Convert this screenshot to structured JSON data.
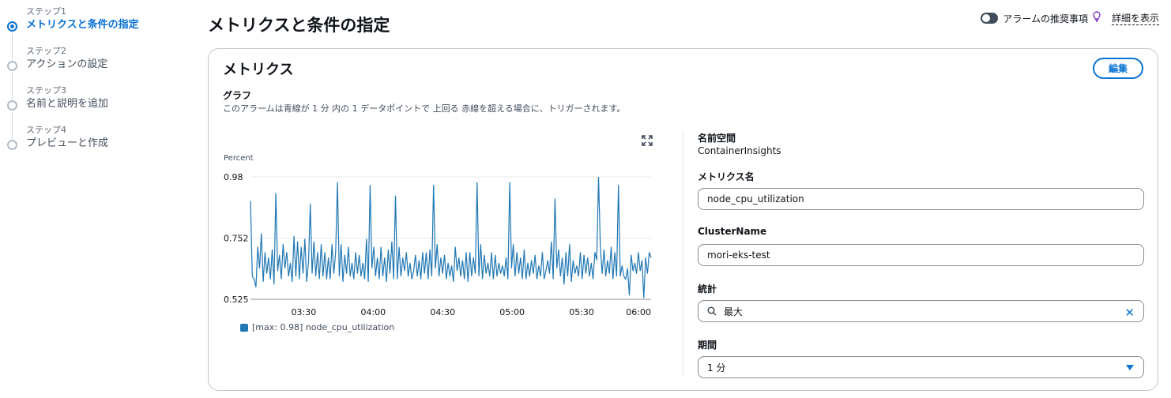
{
  "steps": [
    {
      "sub": "ステップ1",
      "title": "メトリクスと条件の指定",
      "active": true
    },
    {
      "sub": "ステップ2",
      "title": "アクションの設定",
      "active": false
    },
    {
      "sub": "ステップ3",
      "title": "名前と説明を追加",
      "active": false
    },
    {
      "sub": "ステップ4",
      "title": "プレビューと作成",
      "active": false
    }
  ],
  "header": {
    "title": "メトリクスと条件の指定",
    "recommendations_label": "アラームの推奨事項",
    "info_link": "詳細を表示"
  },
  "card": {
    "title": "メトリクス",
    "edit_label": "編集",
    "graph_label": "グラフ",
    "graph_desc": "このアラームは青線が 1 分 内の 1 データポイントで 上回る 赤線を超える場合に、トリガーされます。"
  },
  "fields": {
    "namespace_label": "名前空間",
    "namespace_value": "ContainerInsights",
    "metric_name_label": "メトリクス名",
    "metric_name_value": "node_cpu_utilization",
    "cluster_label": "ClusterName",
    "cluster_value": "mori-eks-test",
    "stat_label": "統計",
    "stat_value": "最大",
    "period_label": "期間",
    "period_value": "1 分"
  },
  "colors": {
    "accent": "#0972d3",
    "series": "#1f77b4"
  },
  "chart_data": {
    "type": "line",
    "ylabel": "Percent",
    "yticks": [
      0.98,
      0.752,
      0.525
    ],
    "ylim": [
      0.525,
      0.98
    ],
    "xticks": [
      "03:30",
      "04:00",
      "04:30",
      "05:00",
      "05:30",
      "06:00"
    ],
    "x_start": "03:07",
    "x_end": "06:00",
    "legend": "[max: 0.98] node_cpu_utilization",
    "series": [
      {
        "name": "node_cpu_utilization",
        "values": [
          0.89,
          0.61,
          0.6,
          0.57,
          0.72,
          0.64,
          0.77,
          0.59,
          0.7,
          0.62,
          0.68,
          0.6,
          0.71,
          0.58,
          0.92,
          0.63,
          0.69,
          0.6,
          0.73,
          0.64,
          0.7,
          0.61,
          0.66,
          0.59,
          0.76,
          0.61,
          0.74,
          0.6,
          0.72,
          0.62,
          0.75,
          0.59,
          0.66,
          0.88,
          0.62,
          0.74,
          0.61,
          0.7,
          0.6,
          0.73,
          0.61,
          0.7,
          0.6,
          0.68,
          0.6,
          0.73,
          0.62,
          0.7,
          0.96,
          0.61,
          0.73,
          0.59,
          0.69,
          0.62,
          0.72,
          0.61,
          0.66,
          0.6,
          0.7,
          0.62,
          0.69,
          0.61,
          0.66,
          0.6,
          0.75,
          0.59,
          0.95,
          0.64,
          0.72,
          0.61,
          0.68,
          0.6,
          0.72,
          0.61,
          0.68,
          0.59,
          0.71,
          0.62,
          0.74,
          0.6,
          0.91,
          0.6,
          0.72,
          0.61,
          0.68,
          0.63,
          0.7,
          0.61,
          0.66,
          0.6,
          0.63,
          0.69,
          0.61,
          0.67,
          0.6,
          0.7,
          0.62,
          0.7,
          0.6,
          0.71,
          0.61,
          0.95,
          0.64,
          0.73,
          0.61,
          0.68,
          0.62,
          0.69,
          0.6,
          0.66,
          0.61,
          0.65,
          0.59,
          0.72,
          0.63,
          0.68,
          0.61,
          0.67,
          0.6,
          0.7,
          0.59,
          0.7,
          0.61,
          0.68,
          0.62,
          0.96,
          0.61,
          0.73,
          0.6,
          0.69,
          0.62,
          0.66,
          0.61,
          0.7,
          0.6,
          0.69,
          0.61,
          0.66,
          0.62,
          0.65,
          0.61,
          0.68,
          0.6,
          0.96,
          0.64,
          0.73,
          0.61,
          0.7,
          0.62,
          0.68,
          0.6,
          0.71,
          0.6,
          0.66,
          0.61,
          0.67,
          0.62,
          0.69,
          0.6,
          0.65,
          0.61,
          0.7,
          0.6,
          0.63,
          0.67,
          0.62,
          0.74,
          0.6,
          0.9,
          0.64,
          0.71,
          0.61,
          0.68,
          0.58,
          0.7,
          0.61,
          0.73,
          0.59,
          0.67,
          0.62,
          0.65,
          0.61,
          0.7,
          0.6,
          0.69,
          0.62,
          0.68,
          0.61,
          0.66,
          0.6,
          0.7,
          0.67,
          0.98,
          0.72,
          0.62,
          0.71,
          0.61,
          0.67,
          0.62,
          0.72,
          0.6,
          0.7,
          0.61,
          0.95,
          0.61,
          0.65,
          0.61,
          0.6,
          0.64,
          0.54,
          0.69,
          0.63,
          0.66,
          0.62,
          0.7,
          0.63,
          0.67,
          0.53,
          0.68,
          0.62,
          0.7,
          0.68
        ]
      }
    ]
  }
}
